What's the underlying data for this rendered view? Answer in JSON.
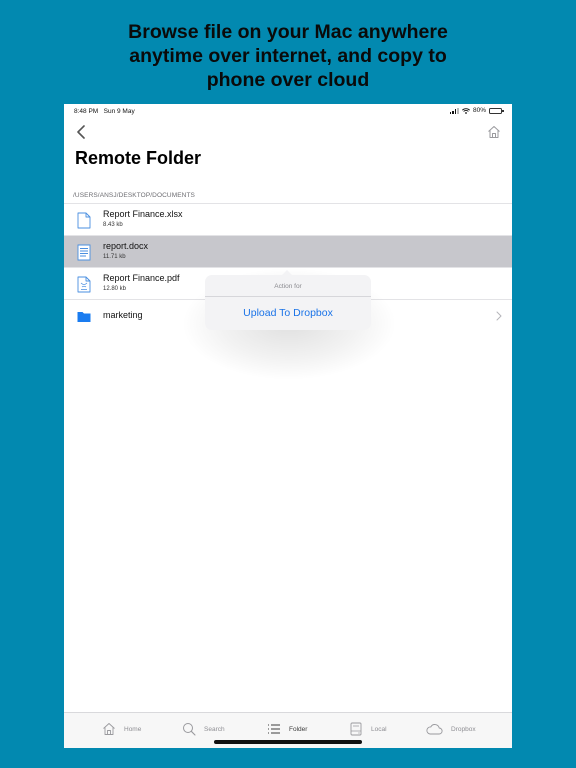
{
  "headline": {
    "line1": "Browse file on your Mac anywhere",
    "line2": "anytime over internet, and copy to",
    "line3": "phone over cloud"
  },
  "status_bar": {
    "time": "8:48 PM",
    "date": "Sun 9 May",
    "battery": "80%"
  },
  "nav": {
    "back_icon": "chevron-left-icon",
    "home_icon": "home-icon"
  },
  "page_title": "Remote Folder",
  "path": "/USERS/ANSJ/DESKTOP/DOCUMENTS",
  "files": [
    {
      "name": "Report Finance.xlsx",
      "size": "8.43 kb",
      "icon": "document-icon"
    },
    {
      "name": "report.docx",
      "size": "11.71 kb",
      "icon": "word-document-icon"
    },
    {
      "name": "Report Finance.pdf",
      "size": "12.80 kb",
      "icon": "pdf-icon"
    },
    {
      "name": "marketing",
      "icon": "folder-icon"
    }
  ],
  "popover": {
    "title": "Action for",
    "action": "Upload To Dropbox"
  },
  "tabs": [
    {
      "label": "Home",
      "icon": "home-icon"
    },
    {
      "label": "Search",
      "icon": "search-icon"
    },
    {
      "label": "Folder",
      "icon": "list-icon"
    },
    {
      "label": "Local",
      "icon": "hard-drive-icon"
    },
    {
      "label": "Dropbox",
      "icon": "cloud-icon"
    }
  ],
  "colors": {
    "background": "#0289b0",
    "accent": "#1a73e8",
    "folder": "#1a7cf0",
    "selected_row": "#c7c7cc"
  }
}
